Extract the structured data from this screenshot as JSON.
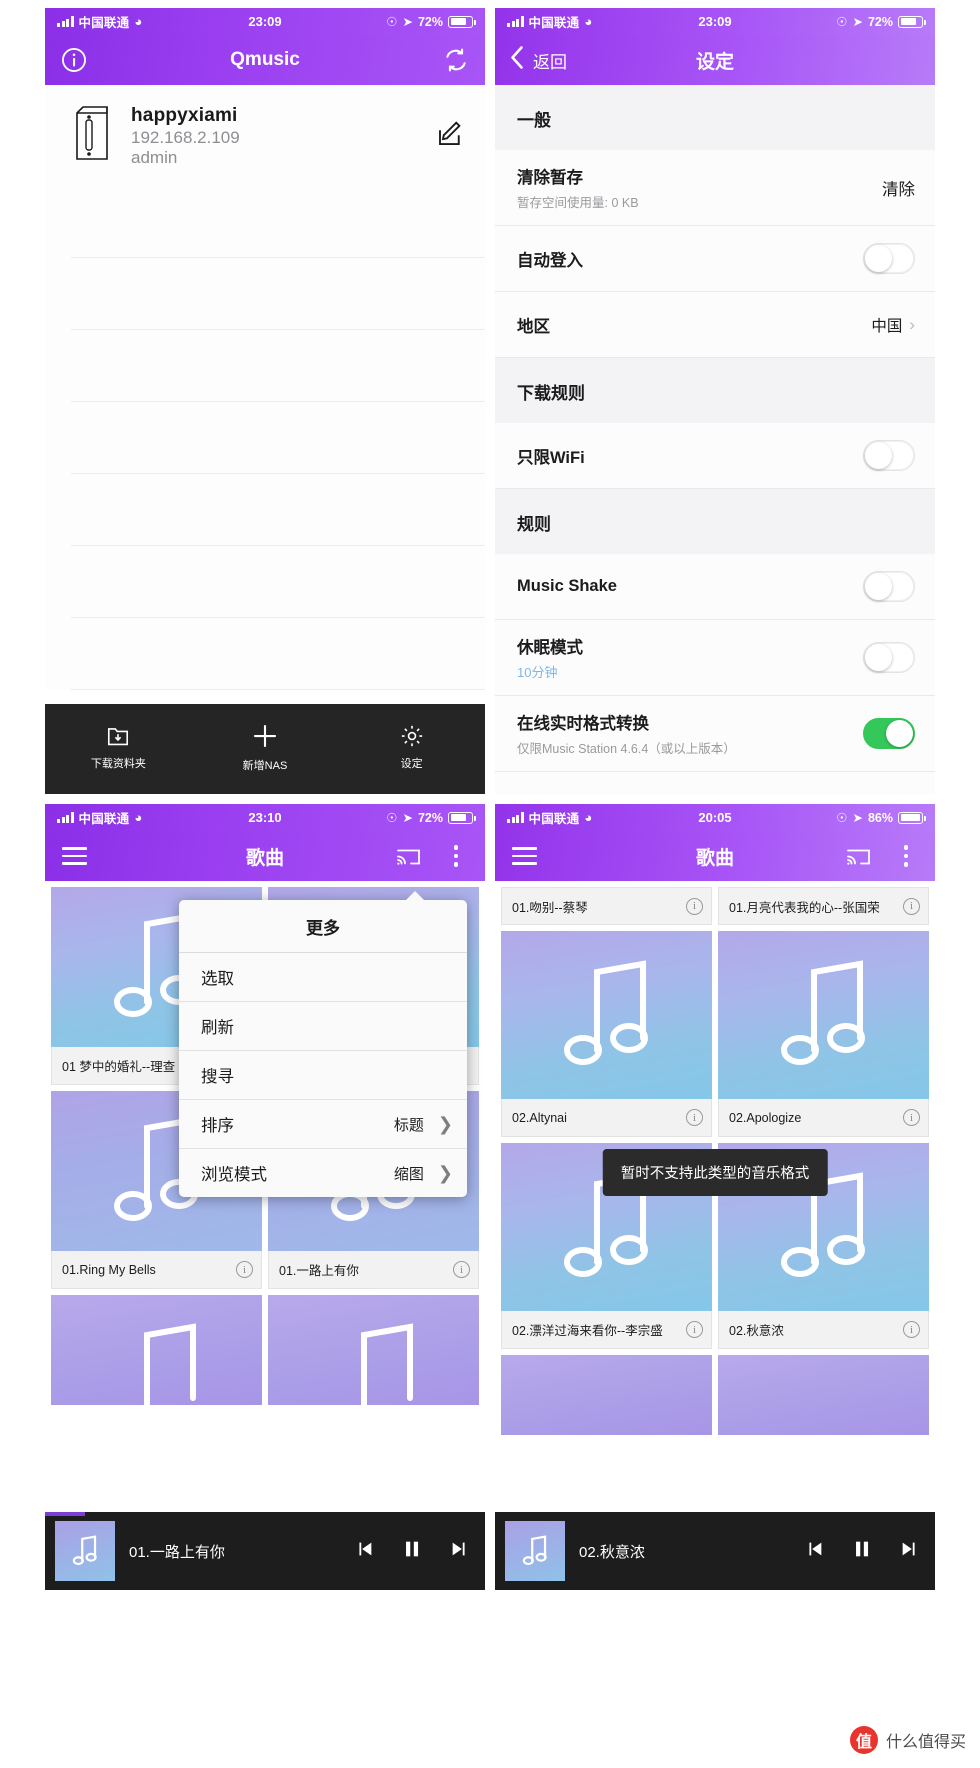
{
  "panel1": {
    "status": {
      "carrier": "中国联通",
      "time": "23:09",
      "battery": "72%",
      "wifi_icon": "wifi-icon",
      "signal_icon": "signal-bars-icon",
      "location_icon": "location-arrow-icon",
      "lock_icon": "rotation-lock-icon"
    },
    "nav": {
      "title": "Qmusic",
      "left_icon": "info-circle-icon",
      "right_icon": "refresh-icon"
    },
    "nas": {
      "name": "happyxiami",
      "ip": "192.168.2.109",
      "user": "admin",
      "device_icon": "nas-tower-icon",
      "edit_icon": "edit-pencil-icon"
    },
    "tabs": [
      {
        "label": "下载资料夹",
        "icon": "download-folder-icon"
      },
      {
        "label": "新增NAS",
        "icon": "plus-icon"
      },
      {
        "label": "设定",
        "icon": "gear-icon"
      }
    ]
  },
  "panel2": {
    "status": {
      "carrier": "中国联通",
      "time": "23:09",
      "battery": "72%"
    },
    "nav": {
      "back_label": "返回",
      "title": "设定",
      "back_icon": "chevron-left-icon"
    },
    "sections": [
      {
        "header": "一般",
        "rows": [
          {
            "label": "清除暂存",
            "sub": "暂存空间使用量: 0 KB",
            "action": "清除",
            "control": "action"
          },
          {
            "label": "自动登入",
            "control": "switch",
            "on": false
          },
          {
            "label": "地区",
            "value": "中国",
            "control": "chevron"
          }
        ]
      },
      {
        "header": "下载规则",
        "rows": [
          {
            "label": "只限WiFi",
            "control": "switch",
            "on": false
          }
        ]
      },
      {
        "header": "规则",
        "rows": [
          {
            "label": "Music Shake",
            "control": "switch",
            "on": false
          },
          {
            "label": "休眠模式",
            "sub": "10分钟",
            "sub_blue": true,
            "control": "switch",
            "on": false
          },
          {
            "label": "在线实时格式转换",
            "sub": "仅限Music Station 4.6.4（或以上版本）",
            "control": "switch",
            "on": true
          }
        ]
      }
    ]
  },
  "panel3": {
    "status": {
      "carrier": "中国联通",
      "time": "23:10",
      "battery": "72%"
    },
    "nav": {
      "title": "歌曲",
      "menu_icon": "hamburger-icon",
      "cast_icon": "chromecast-icon",
      "more_icon": "more-vertical-icon"
    },
    "popup": {
      "title": "更多",
      "items": [
        {
          "label": "选取"
        },
        {
          "label": "刷新"
        },
        {
          "label": "搜寻"
        },
        {
          "label": "排序",
          "value": "标题",
          "chevron": true
        },
        {
          "label": "浏览模式",
          "value": "缩图",
          "chevron": true
        }
      ]
    },
    "songs": [
      {
        "title": "01 梦中的婚礼--理查"
      },
      {
        "title": ""
      },
      {
        "title": "01.Ring My Bells"
      },
      {
        "title": "01.一路上有你"
      }
    ],
    "player": {
      "title": "01.一路上有你",
      "prev_icon": "skip-previous-icon",
      "play_icon": "pause-icon",
      "next_icon": "skip-next-icon",
      "progress_percent": 9
    }
  },
  "panel4": {
    "status": {
      "carrier": "中国联通",
      "time": "20:05",
      "battery": "86%"
    },
    "nav": {
      "title": "歌曲",
      "menu_icon": "hamburger-icon",
      "cast_icon": "chromecast-icon",
      "more_icon": "more-vertical-icon"
    },
    "top_captions": [
      "01.吻别--蔡琴",
      "01.月亮代表我的心--张国荣"
    ],
    "songs_row1": [
      "02.Altynai",
      "02.Apologize"
    ],
    "songs_row2": [
      "02.漂洋过海来看你--李宗盛",
      "02.秋意浓"
    ],
    "toast": "暂时不支持此类型的音乐格式",
    "player": {
      "title": "02.秋意浓",
      "prev_icon": "skip-previous-icon",
      "play_icon": "pause-icon",
      "next_icon": "skip-next-icon",
      "progress_percent": 0
    }
  },
  "watermark": {
    "badge": "值",
    "text": "什么值得买"
  },
  "colors": {
    "purple": "#9a3ff0",
    "green": "#34c759",
    "dark": "#252525",
    "toast_bg": "#2b2b2b",
    "link_blue": "#7fb8e8"
  }
}
